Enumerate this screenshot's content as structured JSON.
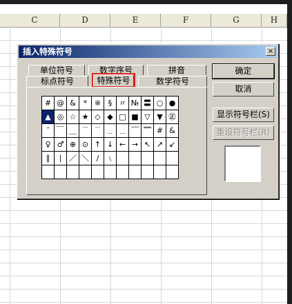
{
  "spreadsheet": {
    "columns": [
      "C",
      "D",
      "E",
      "F",
      "G",
      "H"
    ]
  },
  "dialog": {
    "title": "插入特殊符号",
    "close_glyph": "×",
    "tabs_back": [
      "单位符号",
      "数字序号",
      "拼音"
    ],
    "tabs_front": [
      "标点符号",
      "特殊符号",
      "数学符号"
    ],
    "active_tab": "特殊符号",
    "symbols": [
      [
        "#",
        "@",
        "&",
        "*",
        "※",
        "§",
        "〃",
        "№",
        "〓",
        "○",
        "●",
        "△"
      ],
      [
        "▲",
        "◎",
        "☆",
        "★",
        "◇",
        "◆",
        "□",
        "■",
        "▽",
        "▼",
        "㊣",
        "%"
      ],
      [
        "ˉ",
        "￣",
        "＿",
        "﹉",
        "﹊",
        "﹍",
        "﹎",
        "﹋",
        "﹌",
        "#",
        "&",
        "*"
      ],
      [
        "♀",
        "♂",
        "⊕",
        "⊙",
        "↑",
        "↓",
        "←",
        "→",
        "↖",
        "↗",
        "↙",
        "↘"
      ],
      [
        "∥",
        "∣",
        "／",
        "＼",
        "∕",
        "﹨",
        "",
        "",
        "",
        "",
        "",
        ""
      ],
      [
        "",
        "",
        "",
        "",
        "",
        "",
        "",
        "",
        "",
        "",
        "",
        ""
      ]
    ],
    "selected_symbol": "▲",
    "buttons": {
      "ok": "确定",
      "cancel": "取消",
      "show_bar": "显示符号栏(S)",
      "reset_bar": "重设符号栏(R)"
    },
    "colors": {
      "highlight": "#e0221a",
      "titlebar": "#0a246a",
      "selection": "#0a246a"
    }
  }
}
